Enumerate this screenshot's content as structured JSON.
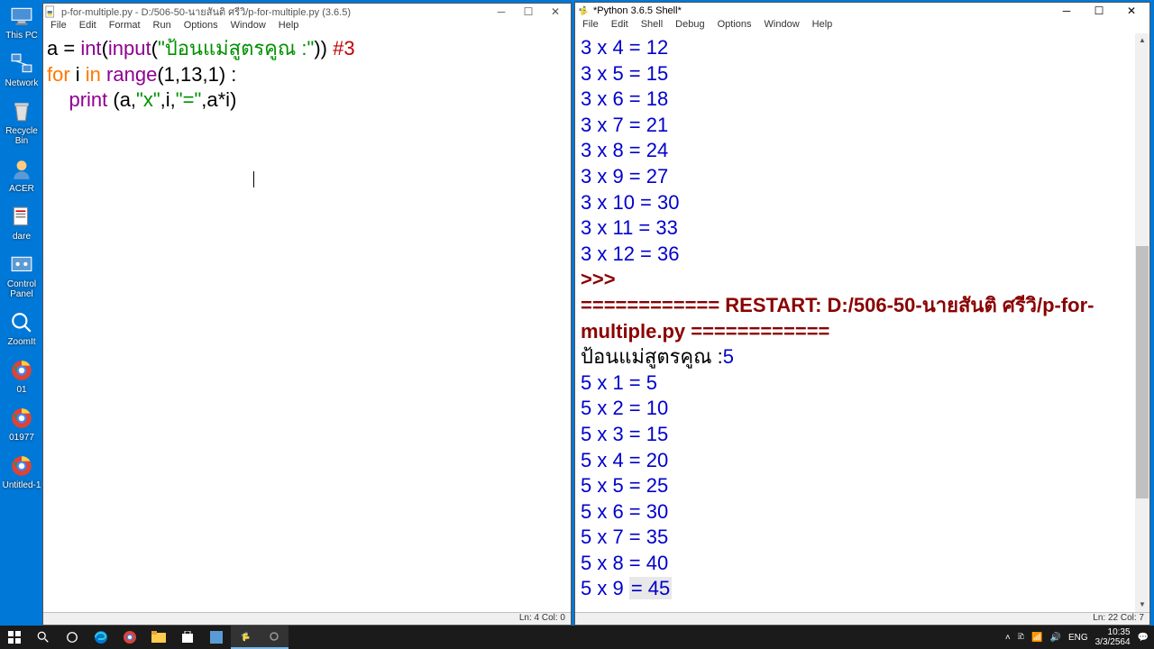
{
  "desktop_icons": [
    {
      "label": "This PC",
      "icon": "pc"
    },
    {
      "label": "Network",
      "icon": "net"
    },
    {
      "label": "Recycle Bin",
      "icon": "bin"
    },
    {
      "label": "ACER",
      "icon": "user"
    },
    {
      "label": "dare",
      "icon": "file"
    },
    {
      "label": "Control Panel",
      "icon": "cp"
    },
    {
      "label": "ZoomIt",
      "icon": "zoom"
    },
    {
      "label": "01",
      "icon": "chrome"
    },
    {
      "label": "01977",
      "icon": "chrome"
    },
    {
      "label": "Untitled-1",
      "icon": "chrome"
    }
  ],
  "editor": {
    "title": "p-for-multiple.py - D:/506-50-นายสันติ  ศรีวิ/p-for-multiple.py (3.6.5)",
    "menus": [
      "File",
      "Edit",
      "Format",
      "Run",
      "Options",
      "Window",
      "Help"
    ],
    "status": "Ln: 4  Col: 0",
    "code": {
      "l1a": "a = ",
      "l1fn": "int",
      "l1b": "(",
      "l1fn2": "input",
      "l1c": "(",
      "l1str": "\"ป้อนแม่สูตรคูณ :\"",
      "l1d": ")) ",
      "l1cm": "#3",
      "l2a": "for ",
      "l2b": "i ",
      "l2c": "in ",
      "l2fn": "range",
      "l2d": "(1,13,1) :",
      "l3a": "    ",
      "l3fn": "print",
      "l3b": " (a,",
      "l3s1": "\"x\"",
      "l3c": ",i,",
      "l3s2": "\"=\"",
      "l3d": ",a*i)"
    }
  },
  "shell": {
    "title": "*Python 3.6.5 Shell*",
    "menus": [
      "File",
      "Edit",
      "Shell",
      "Debug",
      "Options",
      "Window",
      "Help"
    ],
    "status": "Ln: 22  Col: 7",
    "lines3": [
      "3 x 4 = 12",
      "3 x 5 = 15",
      "3 x 6 = 18",
      "3 x 7 = 21",
      "3 x 8 = 24",
      "3 x 9 = 27",
      "3 x 10 = 30",
      "3 x 11 = 33",
      "3 x 12 = 36"
    ],
    "prompt": ">>> ",
    "restart": "============ RESTART: D:/506-50-นายสันติ  ศรีวิ/p-for-multiple.py ============",
    "input_prompt": "ป้อนแม่สูตรคูณ :",
    "input_val": "5",
    "lines5": [
      "5 x 1 = 5",
      "5 x 2 = 10",
      "5 x 3 = 15",
      "5 x 4 = 20",
      "5 x 5 = 25",
      "5 x 6 = 30",
      "5 x 7 = 35",
      "5 x 8 = 40"
    ],
    "last_a": "5 x 9 ",
    "last_b": "= 45"
  },
  "taskbar": {
    "tray": {
      "time": "10:35",
      "date": "3/3/2564",
      "lang": "ENG"
    }
  }
}
